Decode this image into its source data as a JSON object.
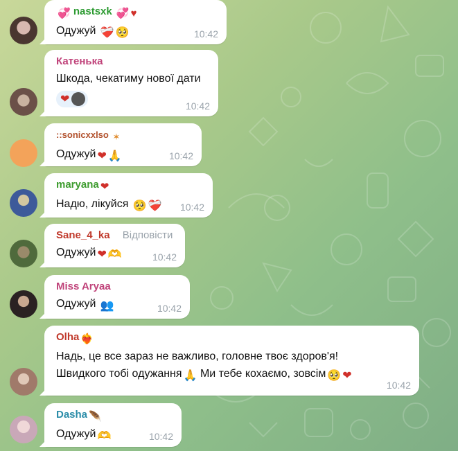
{
  "messages": [
    {
      "sender": "nastsxk",
      "text": "Одужуй",
      "time": "10:42",
      "color": "#2d9b32"
    },
    {
      "sender": "Катенька",
      "text": "Шкода, чекатиму нової дати",
      "time": "10:42",
      "color": "#c0437a"
    },
    {
      "sender": "::sonicxxlso",
      "text": "Одужуй",
      "time": "10:42",
      "color": "#b2512d"
    },
    {
      "sender": "maryana",
      "text": "Надю, лікуйся",
      "time": "10:42",
      "color": "#3c9b2d"
    },
    {
      "sender": "Sane_4_ka",
      "reply_label": "Відповісти",
      "text": "Одужуй",
      "time": "10:42",
      "color": "#c0392b"
    },
    {
      "sender": "Miss Aryaa",
      "text": "Одужуй",
      "time": "10:42",
      "color": "#c0437a"
    },
    {
      "sender": "Olha",
      "text_line1": "Надь, це все зараз не важливо, головне твоє здоров'я!",
      "text_line2": "Швидкого тобі одужання",
      "text_line2b": "Ми тебе кохаємо, зовсім",
      "time": "10:42",
      "color": "#c0392b"
    },
    {
      "sender": "Dasha",
      "text": "Одужуй",
      "time": "10:42",
      "color": "#2a8ca8"
    }
  ]
}
